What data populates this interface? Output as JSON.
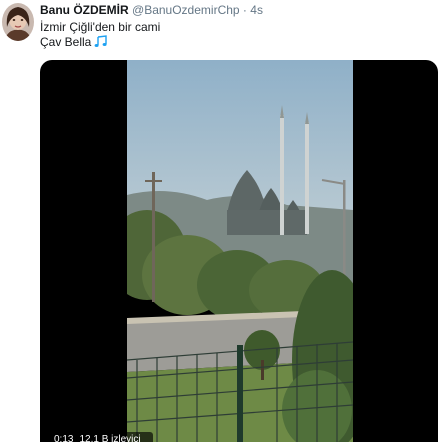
{
  "tweet": {
    "author_name": "Banu ÖZDEMİR",
    "handle": "@BanuOzdemirChp",
    "separator": "·",
    "timestamp": "4s",
    "text_line1": "İzmir Çiğli'den bir cami",
    "text_line2": "Çav Bella",
    "emoji_icon": "musical-notes-icon"
  },
  "video": {
    "elapsed": "0:13",
    "views": "12,1 B izleyici"
  },
  "colors": {
    "text_primary": "#14171a",
    "text_secondary": "#657786",
    "link_blue": "#1da1f2",
    "video_background": "#000000"
  }
}
